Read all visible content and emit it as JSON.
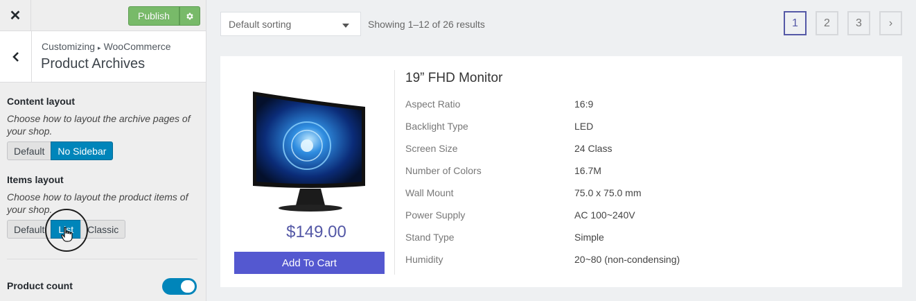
{
  "customizer": {
    "close_label": "✕",
    "publish_label": "Publish",
    "breadcrumb": {
      "root": "Customizing",
      "separator": "▸",
      "panel": "WooCommerce"
    },
    "section_title": "Product Archives",
    "content_layout": {
      "title": "Content layout",
      "description": "Choose how to layout the archive pages of your shop.",
      "options": [
        "Default",
        "No Sidebar"
      ],
      "selected": "No Sidebar"
    },
    "items_layout": {
      "title": "Items layout",
      "description": "Choose how to layout the product items of your shop.",
      "options": [
        "Default",
        "List",
        "Classic"
      ],
      "selected": "List"
    },
    "product_count": {
      "title": "Product count",
      "enabled": true
    }
  },
  "preview": {
    "sorting": {
      "value": "Default sorting"
    },
    "results_text": "Showing 1–12 of 26 results",
    "pagination": {
      "pages": [
        "1",
        "2",
        "3"
      ],
      "current": "1",
      "next_label": "›"
    },
    "product": {
      "title": "19” FHD Monitor",
      "price": "$149.00",
      "cart_button": "Add To Cart",
      "specs": [
        {
          "label": "Aspect Ratio",
          "value": "16:9"
        },
        {
          "label": "Backlight Type",
          "value": "LED"
        },
        {
          "label": "Screen Size",
          "value": "24 Class"
        },
        {
          "label": "Number of Colors",
          "value": "16.7M"
        },
        {
          "label": "Wall Mount",
          "value": "75.0 x 75.0 mm"
        },
        {
          "label": "Power Supply",
          "value": "AC 100~240V"
        },
        {
          "label": "Stand Type",
          "value": "Simple"
        },
        {
          "label": "Humidity",
          "value": "20~80 (non-condensing)"
        }
      ]
    }
  },
  "colors": {
    "accent": "#0085ba",
    "publish": "#78ba69",
    "brand": "#5458a6",
    "cart_button": "#5458d0"
  }
}
